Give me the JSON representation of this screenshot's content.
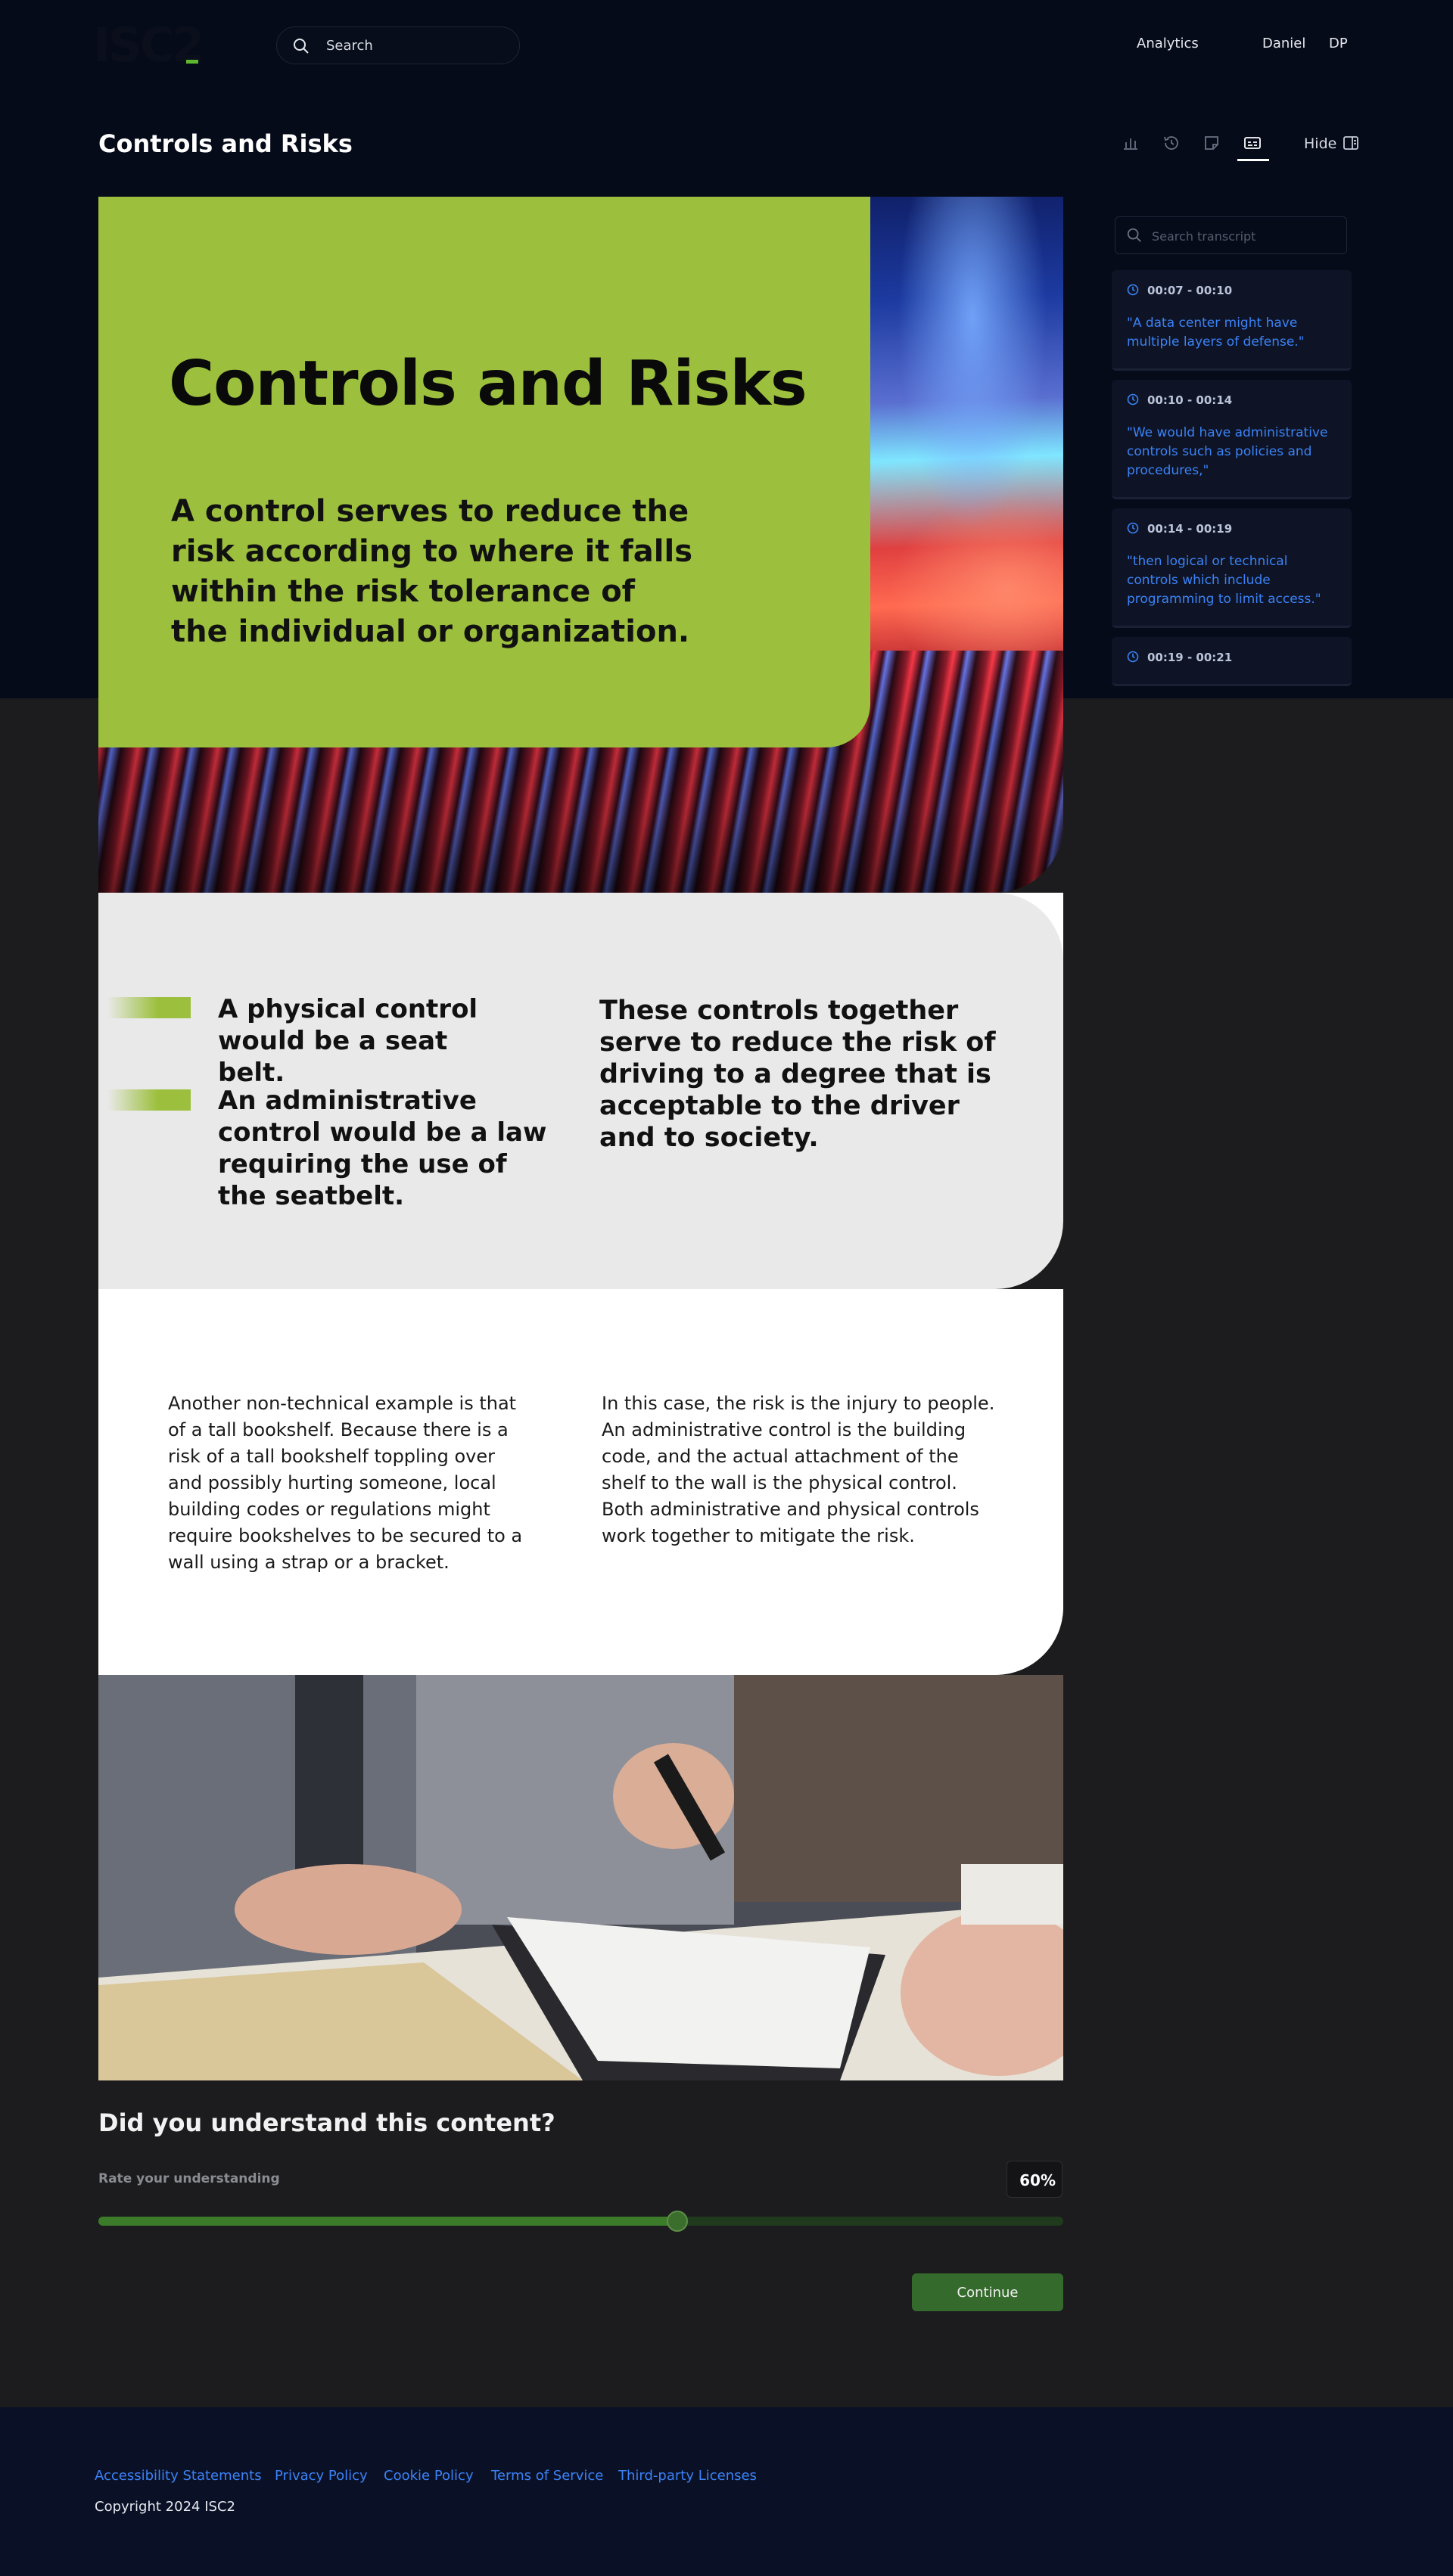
{
  "app": {
    "logo_text": "ISC2",
    "search_placeholder": "Search"
  },
  "nav": {
    "analytics": "Analytics",
    "user_name": "Daniel",
    "user_initials": "DP"
  },
  "page": {
    "title": "Controls and Risks",
    "hide_label": "Hide"
  },
  "slide": {
    "hero_title": "Controls and Risks",
    "hero_subtitle": "A control serves to reduce the risk according to where it falls within the risk tolerance of the individual or organization.",
    "bullet_1": "A physical control would be a seat belt.",
    "bullet_2": "An administrative control would be a law requiring the use of the seatbelt.",
    "right_statement": "These controls together serve to reduce the risk of driving to a degree that is acceptable to the driver and to society.",
    "body_left": "Another non-technical example is that of a tall bookshelf. Because there is a risk of a tall bookshelf toppling over and possibly hurting someone, local building codes or regulations might require bookshelves to be secured to a wall using a strap or a bracket.",
    "body_right": "In this case, the risk is the injury to people. An administrative control is the building code, and the actual attachment of the shelf to the wall is the physical control. Both administrative and physical controls work together to mitigate the risk."
  },
  "transcript": {
    "search_placeholder": "Search transcript",
    "entries": [
      {
        "time": "00:07 - 00:10",
        "text": "\"A data center might have multiple layers of defense.\""
      },
      {
        "time": "00:10 - 00:14",
        "text": "\"We would have administrative controls such as policies and procedures,\""
      },
      {
        "time": "00:14 - 00:19",
        "text": "\"then logical or technical controls which include programming to limit access.\""
      },
      {
        "time": "00:19 - 00:21",
        "text": ""
      }
    ]
  },
  "rating": {
    "question": "Did you understand this content?",
    "label": "Rate your understanding",
    "value_display": "60%",
    "value": 0.6,
    "continue_label": "Continue"
  },
  "footer": {
    "links": [
      "Accessibility Statements",
      "Privacy Policy",
      "Cookie Policy",
      "Terms of Service",
      "Third-party Licenses"
    ],
    "copyright": "Copyright 2024 ISC2"
  },
  "colors": {
    "accent_green": "#9cc03d",
    "link_blue": "#3b82f6",
    "navy": "#060b19",
    "button_green": "#346a2b"
  }
}
